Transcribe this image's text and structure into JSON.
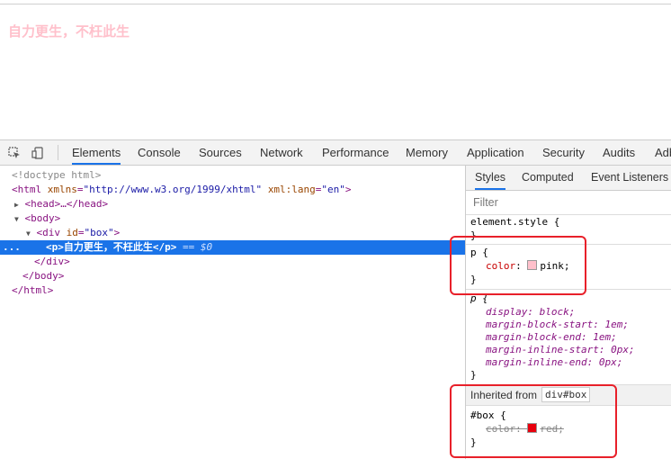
{
  "page": {
    "text": "自力更生，不枉此生",
    "text_color": "#ffc0cb"
  },
  "devtools": {
    "toolbar": {
      "inspect_icon": "select-element-icon",
      "device_icon": "device-toggle-icon",
      "tabs": [
        "Elements",
        "Console",
        "Sources",
        "Network",
        "Performance",
        "Memory",
        "Application",
        "Security",
        "Audits",
        "Adb"
      ],
      "active_tab": "Elements"
    },
    "elements": {
      "doctype": "<!doctype html>",
      "html_open_tag": "<html ",
      "html_attr1_name": "xmlns",
      "html_attr1_value": "\"http://www.w3.org/1999/xhtml\"",
      "html_attr2_name": "xml:lang",
      "html_attr2_value": "\"en\"",
      "html_close_bracket": ">",
      "head_collapsed": "<head>…</head>",
      "body_open": "<body>",
      "div_open_tag": "<div ",
      "div_attr_name": "id",
      "div_attr_value": "\"box\"",
      "div_close_bracket": ">",
      "selected_node": "<p>自力更生，不枉此生</p>",
      "selected_suffix": " == $0",
      "ellipsis": "...",
      "div_close": "</div>",
      "body_close": "</body>",
      "html_close": "</html>"
    },
    "styles": {
      "tabs": [
        "Styles",
        "Computed",
        "Event Listeners"
      ],
      "active_tab": "Styles",
      "filter_placeholder": "Filter",
      "element_style_selector": "element.style {",
      "close_brace": "}",
      "p_rule": {
        "selector": "p {",
        "prop": "color",
        "value": "pink;",
        "swatch": "#ffc0cb"
      },
      "ua_rule": {
        "selector": "p {",
        "decls": [
          "display: block;",
          "margin-block-start: 1em;",
          "margin-block-end: 1em;",
          "margin-inline-start: 0px;",
          "margin-inline-end: 0px;"
        ]
      },
      "inherited_label": "Inherited from",
      "inherited_node": "div#box",
      "box_rule": {
        "selector": "#box {",
        "prop": "color",
        "value": "red;",
        "swatch": "#e8000d"
      }
    },
    "highlight_color": "#e8202a"
  }
}
